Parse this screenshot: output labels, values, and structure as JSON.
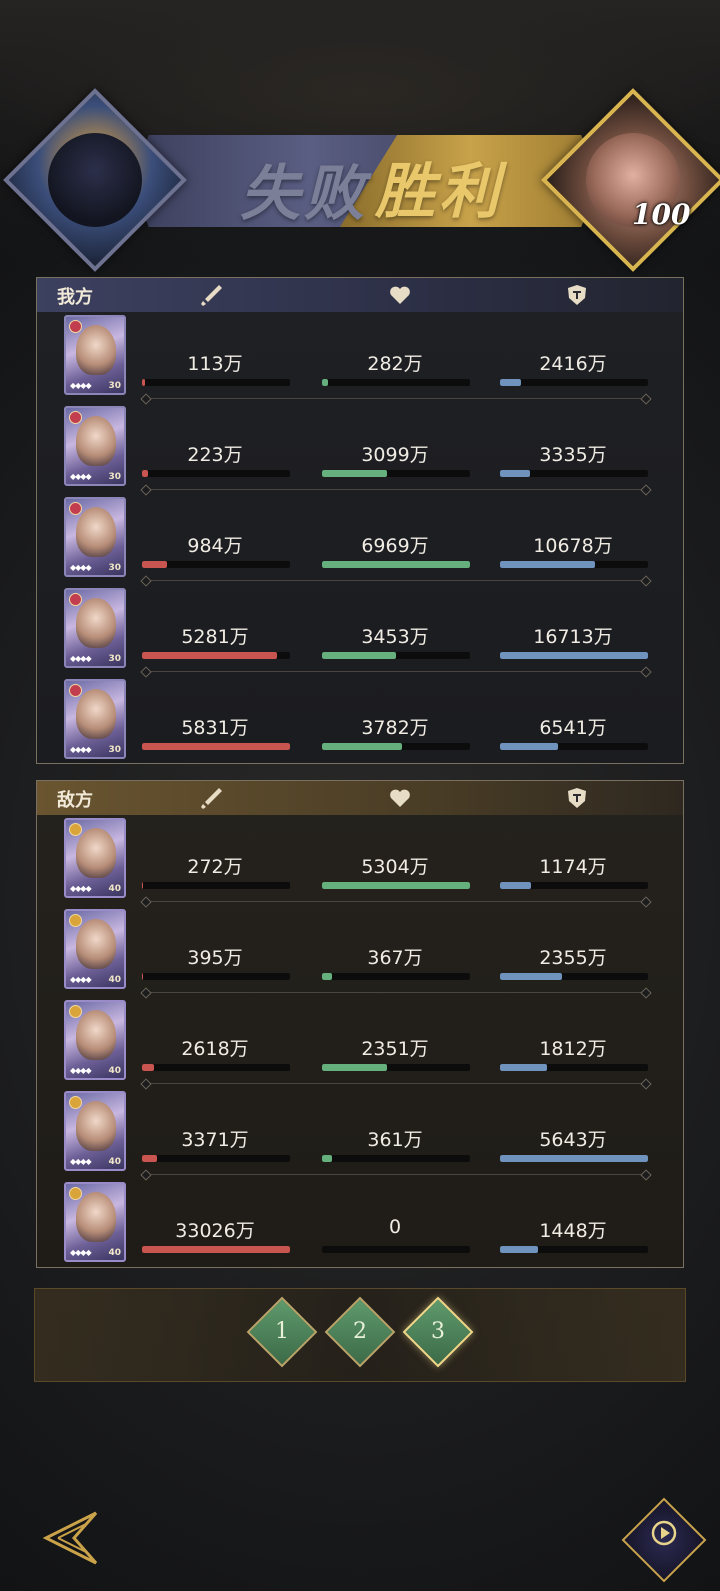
{
  "banner": {
    "defeat_label": "失败",
    "victory_label": "胜利",
    "enemy_level": "100"
  },
  "ally": {
    "title": "我方",
    "rows": [
      {
        "damage": "113万",
        "damage_pct": 2,
        "healing": "282万",
        "healing_pct": 4,
        "taken": "2416万",
        "taken_pct": 14,
        "level": "30"
      },
      {
        "damage": "223万",
        "damage_pct": 4,
        "healing": "3099万",
        "healing_pct": 44,
        "taken": "3335万",
        "taken_pct": 20,
        "level": "30"
      },
      {
        "damage": "984万",
        "damage_pct": 17,
        "healing": "6969万",
        "healing_pct": 100,
        "taken": "10678万",
        "taken_pct": 64,
        "level": "30"
      },
      {
        "damage": "5281万",
        "damage_pct": 91,
        "healing": "3453万",
        "healing_pct": 50,
        "taken": "16713万",
        "taken_pct": 100,
        "level": "30"
      },
      {
        "damage": "5831万",
        "damage_pct": 100,
        "healing": "3782万",
        "healing_pct": 54,
        "taken": "6541万",
        "taken_pct": 39,
        "level": "30"
      }
    ]
  },
  "enemy": {
    "title": "敌方",
    "rows": [
      {
        "damage": "272万",
        "damage_pct": 1,
        "healing": "5304万",
        "healing_pct": 100,
        "taken": "1174万",
        "taken_pct": 21,
        "level": "40"
      },
      {
        "damage": "395万",
        "damage_pct": 1,
        "healing": "367万",
        "healing_pct": 7,
        "taken": "2355万",
        "taken_pct": 42,
        "level": "40"
      },
      {
        "damage": "2618万",
        "damage_pct": 8,
        "healing": "2351万",
        "healing_pct": 44,
        "taken": "1812万",
        "taken_pct": 32,
        "level": "40"
      },
      {
        "damage": "3371万",
        "damage_pct": 10,
        "healing": "361万",
        "healing_pct": 7,
        "taken": "5643万",
        "taken_pct": 100,
        "level": "40"
      },
      {
        "damage": "33026万",
        "damage_pct": 100,
        "healing": "0",
        "healing_pct": 0,
        "taken": "1448万",
        "taken_pct": 26,
        "level": "40"
      }
    ]
  },
  "rounds": [
    "1",
    "2",
    "3"
  ],
  "selected_round": "3",
  "icons": {
    "damage": "sword-icon",
    "healing": "heart-icon",
    "taken": "shield-icon",
    "back": "back-arrow-icon",
    "replay": "replay-icon"
  },
  "colors": {
    "damage": "#c8554f",
    "healing": "#66b07d",
    "taken": "#6f93bd"
  }
}
